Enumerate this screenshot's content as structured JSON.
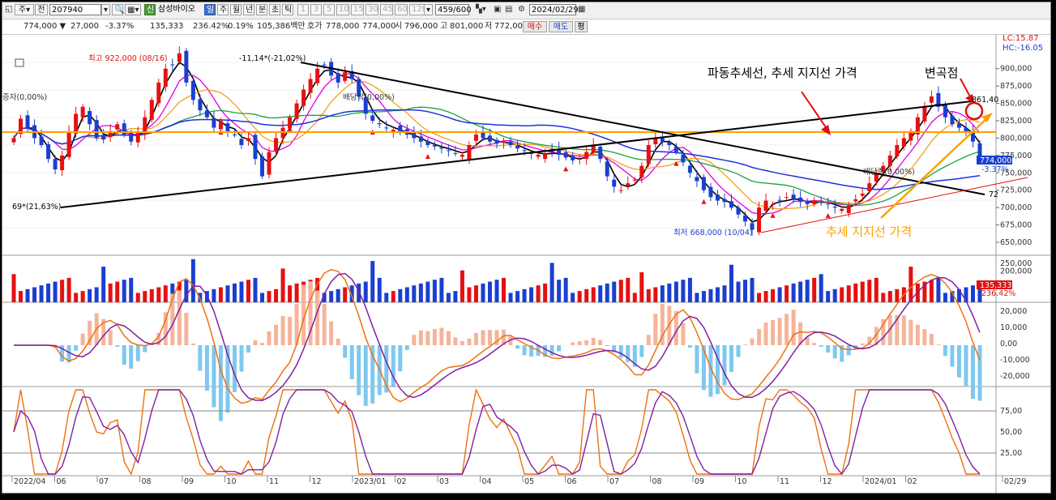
{
  "toolbar": {
    "period_main": "주",
    "prev_label": "전",
    "code": "207940",
    "name_badge": "신",
    "name": "삼성바이오",
    "tf_day": "일",
    "tf_week": "주",
    "tf_month": "월",
    "tf_year": "년",
    "tf_min": "분",
    "tf_sec": "초",
    "tf_tick": "틱",
    "intervals": [
      "1",
      "3",
      "5",
      "10",
      "15",
      "30",
      "45",
      "60",
      "120"
    ],
    "count": "459",
    "count_total": "/600",
    "date": "2024/02/29"
  },
  "quote": {
    "price": "774,000",
    "change": "27,000",
    "change_pct": "-3.37%",
    "volume": "135,333",
    "volume_ratio": "236.42%",
    "turnover": "0.19%",
    "amount": "105,386백만",
    "bid_label": "호가",
    "bid": "778,000",
    "ask": "774,000",
    "open_label": "시",
    "open": "796,000",
    "high_label": "고",
    "high": "801,000",
    "low_label": "저",
    "low": "772,000",
    "buy": "매수",
    "sell": "매도",
    "eval": "평"
  },
  "colors": {
    "up": "#e61010",
    "down": "#1a3fd0",
    "ma5": "#000000",
    "ma10": "#e000e0",
    "ma20": "#f0a020",
    "ma60": "#20a040",
    "ma120": "#2030e0",
    "orange_line": "#ffa000",
    "trend_line": "#000000"
  },
  "chart_data": {
    "type": "candlestick",
    "x_ticks": [
      "2022/04",
      "06",
      "07",
      "08",
      "09",
      "10",
      "11",
      "12",
      "2023/01",
      "02",
      "03",
      "04",
      "05",
      "06",
      "07",
      "08",
      "09",
      "10",
      "11",
      "12",
      "2024/01",
      "02",
      "02/29"
    ],
    "price_axis": [
      "900,000",
      "875,000",
      "850,000",
      "825,000",
      "800,000",
      "775,000",
      "750,000",
      "725,000",
      "700,000",
      "675,000",
      "650,000"
    ],
    "price_range": [
      636000,
      944000
    ],
    "lc_label": "LC:15.87",
    "hc_label": "HC:-16.05",
    "close": [
      800000,
      828000,
      815000,
      800000,
      790000,
      770000,
      755000,
      775000,
      810000,
      835000,
      845000,
      820000,
      800000,
      798000,
      810000,
      820000,
      805000,
      795000,
      808000,
      830000,
      855000,
      880000,
      900000,
      905000,
      922000,
      880000,
      855000,
      840000,
      830000,
      815000,
      825000,
      810000,
      805000,
      790000,
      800000,
      770000,
      745000,
      780000,
      800000,
      815000,
      830000,
      850000,
      870000,
      885000,
      900000,
      905000,
      890000,
      880000,
      895000,
      885000,
      860000,
      835000,
      825000,
      820000,
      815000,
      812000,
      808000,
      805000,
      800000,
      795000,
      790000,
      788000,
      785000,
      782000,
      778000,
      776000,
      790000,
      805000,
      800000,
      795000,
      792000,
      795000,
      790000,
      785000,
      782000,
      778000,
      776000,
      778000,
      780000,
      776000,
      772000,
      768000,
      770000,
      780000,
      790000,
      770000,
      745000,
      730000,
      725000,
      735000,
      740000,
      760000,
      790000,
      800000,
      795000,
      790000,
      780000,
      765000,
      750000,
      738000,
      725000,
      715000,
      710000,
      708000,
      700000,
      690000,
      680000,
      668000,
      700000,
      710000,
      705000,
      710000,
      715000,
      712000,
      708000,
      705000,
      710000,
      708000,
      705000,
      700000,
      698000,
      703000,
      712000,
      720000,
      735000,
      750000,
      760000,
      775000,
      790000,
      800000,
      810000,
      830000,
      845000,
      860000,
      845000,
      830000,
      820000,
      815000,
      810000,
      795000,
      774000
    ],
    "peak_label": "최고 922,000 (08/16)",
    "low_label": "최저 668,000 (10/04)",
    "anno_top": "-11,14*(-21,02%)",
    "anno_left": "69*(21,63%)",
    "anno_right_top": "861,40",
    "anno_right_bottom": "72",
    "anno_div1": "배당락(0,00%)",
    "anno_div2": "배당락(0,00%)",
    "anno_capital": "증자(0,00%)",
    "price_tag": "774,000",
    "price_tag_pct": "-3.37%",
    "volume_axis": [
      "250,000",
      "200,000"
    ],
    "volume_tag": "135,333",
    "volume_tag_pct": "236.42%",
    "macd_axis": [
      "20,000",
      "10,000",
      "0,00",
      "-10,000",
      "-20,000"
    ],
    "stoch_axis": [
      "75,00",
      "50,00",
      "25,00"
    ]
  },
  "annotations": {
    "wave_line": "파동추세선, 추세 지지선 가격",
    "inflection": "변곡점",
    "support_price": "추세 지지선 가격"
  }
}
